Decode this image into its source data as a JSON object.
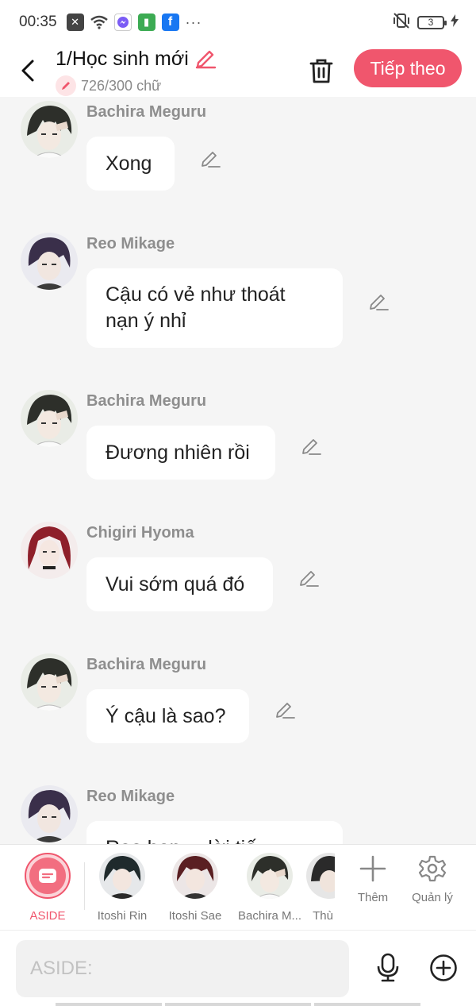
{
  "status": {
    "time": "00:35",
    "battery": "3"
  },
  "header": {
    "title": "1/Học sinh mới",
    "count": "726/300 chữ",
    "next_label": "Tiếp theo"
  },
  "messages": [
    {
      "name": "Bachira Meguru",
      "text": "Xong"
    },
    {
      "name": "Reo Mikage",
      "text": "Cậu có vẻ như thoát nạn ý nhỉ"
    },
    {
      "name": "Bachira Meguru",
      "text": "Đương nhiên rồi"
    },
    {
      "name": "Chigiri Hyoma",
      "text": "Vui sớm quá đó"
    },
    {
      "name": "Bachira Meguru",
      "text": "Ý cậu là sao?"
    },
    {
      "name": "Reo Mikage",
      "text": "Reo bạn ... lời tiế"
    }
  ],
  "characters": [
    {
      "label": "ASIDE"
    },
    {
      "label": "Itoshi Rin"
    },
    {
      "label": "Itoshi Sae"
    },
    {
      "label": "Bachira M..."
    },
    {
      "label": "Thù"
    }
  ],
  "actions": {
    "add_label": "Thêm",
    "manage_label": "Quản lý"
  },
  "input": {
    "placeholder": "ASIDE:"
  },
  "colors": {
    "accent": "#f0566d",
    "background": "#f5f5f5",
    "bubble": "#ffffff"
  },
  "icons": {
    "status": [
      "notification-icon",
      "wifi-icon",
      "messenger-icon",
      "app-icon",
      "facebook-icon",
      "vibrate-off-icon",
      "charging-icon"
    ],
    "header": [
      "back-icon",
      "pencil-icon",
      "trash-icon"
    ],
    "bar": [
      "plus-icon",
      "gear-icon",
      "mic-icon",
      "add-circle-icon"
    ]
  }
}
